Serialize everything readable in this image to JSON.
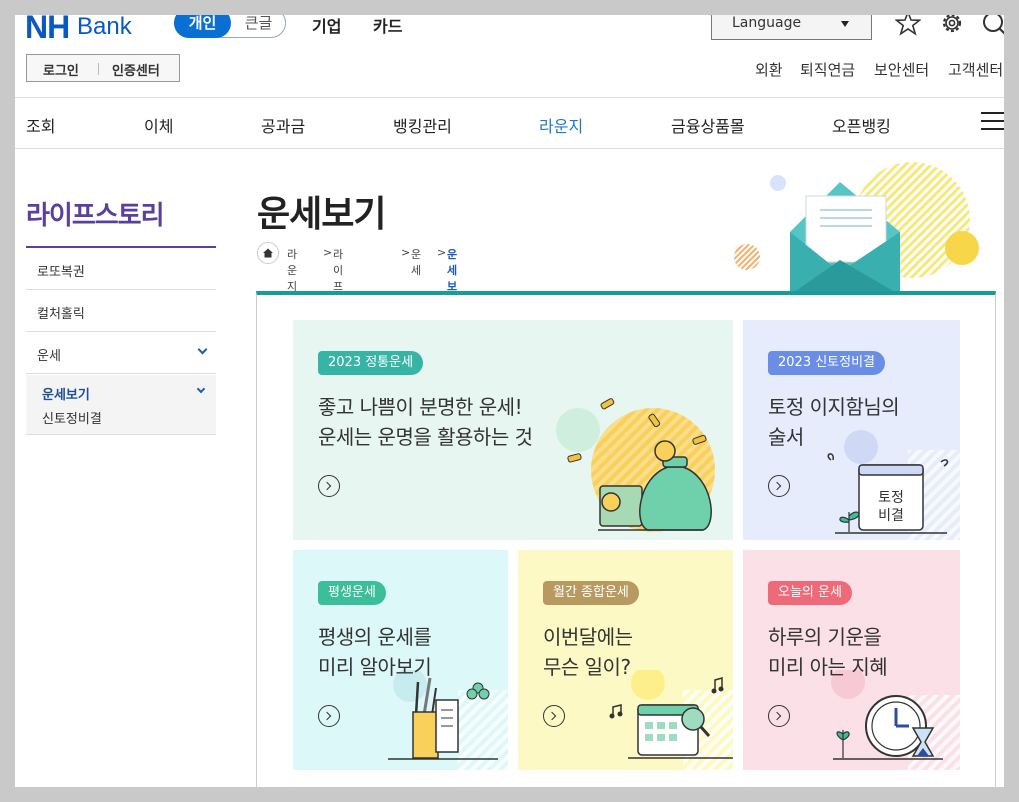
{
  "header": {
    "logo_nh": "NH",
    "logo_bank": "Bank",
    "mode_active": "개인",
    "mode_inactive": "큰글",
    "top_tabs": [
      "기업",
      "카드"
    ],
    "language_label": "Language",
    "login": "로그인",
    "cert_center": "인증센터",
    "util_links": [
      "외환",
      "퇴직연금",
      "보안센터",
      "고객센터"
    ]
  },
  "gnb": {
    "items": [
      "조회",
      "이체",
      "공과금",
      "뱅킹관리",
      "라운지",
      "금융상품몰",
      "오픈뱅킹"
    ],
    "active": "라운지"
  },
  "sidebar": {
    "title": "라이프스토리",
    "items": [
      "로또복권",
      "컬처홀릭",
      "운세"
    ],
    "sub_items": [
      "운세보기",
      "신토정비결"
    ]
  },
  "main": {
    "title": "운세보기",
    "breadcrumb": [
      "라운지",
      "라이프스토리",
      "운세",
      "운세보기"
    ]
  },
  "cards": [
    {
      "badge": "2023 정통운세",
      "line1": "좋고 나쁨이 분명한 운세!",
      "line2": "운세는 운명을 활용하는 것",
      "badge_color": "#36b4a6",
      "bg": "#e8f6f1"
    },
    {
      "badge": "2023 신토정비결",
      "line1": "토정 이지함님의",
      "line2": "술서",
      "badge_color": "#6a8de6",
      "bg": "#e6ecfc",
      "illus_text_1": "토정",
      "illus_text_2": "비결"
    },
    {
      "badge": "평생운세",
      "line1": "평생의 운세를",
      "line2": "미리 알아보기",
      "badge_color": "#3bbf9b",
      "bg": "#ddf8f8"
    },
    {
      "badge": "월간 종합운세",
      "line1": "이번달에는",
      "line2": "무슨 일이?",
      "badge_color": "#b89a60",
      "bg": "#fdf9c4"
    },
    {
      "badge": "오늘의 운세",
      "line1": "하루의 기운을",
      "line2": "미리 아는 지혜",
      "badge_color": "#ef6a78",
      "bg": "#fbe0e7"
    }
  ]
}
